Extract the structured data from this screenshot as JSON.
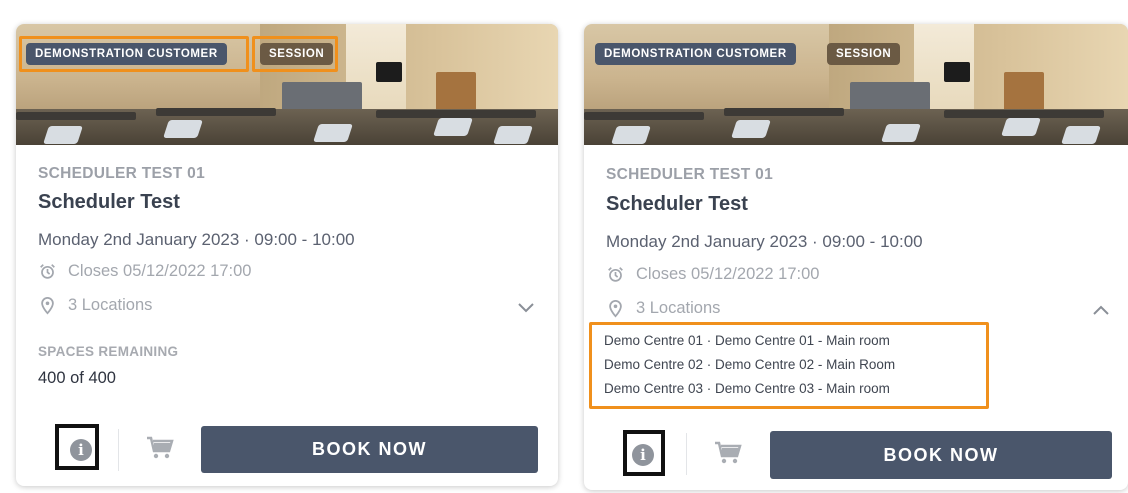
{
  "cards": [
    {
      "badges": {
        "customer": "DEMONSTRATION CUSTOMER",
        "session": "SESSION"
      },
      "subtitle": "SCHEDULER TEST 01",
      "title": "Scheduler Test",
      "datetime": "Monday 2nd January 2023 · 09:00 - 10:00",
      "closes": "Closes 05/12/2022 17:00",
      "locations_count": "3 Locations",
      "locations_expanded": false,
      "spaces_label": "SPACES REMAINING",
      "spaces_value": "400 of 400",
      "book_label": "BOOK NOW"
    },
    {
      "badges": {
        "customer": "DEMONSTRATION CUSTOMER",
        "session": "SESSION"
      },
      "subtitle": "SCHEDULER TEST 01",
      "title": "Scheduler Test",
      "datetime": "Monday 2nd January 2023 · 09:00 - 10:00",
      "closes": "Closes 05/12/2022 17:00",
      "locations_count": "3 Locations",
      "locations_expanded": true,
      "locations": [
        "Demo Centre 01 · Demo Centre 01 - Main room",
        "Demo Centre 02 · Demo Centre 02 - Main Room",
        "Demo Centre 03 · Demo Centre 03 - Main room"
      ],
      "book_label": "BOOK NOW"
    }
  ],
  "icons": {
    "alarm": "alarm-clock-icon",
    "location": "map-pin-icon",
    "chevron_down": "chevron-down-icon",
    "chevron_up": "chevron-up-icon",
    "info": "info-icon",
    "cart": "shopping-cart-icon"
  },
  "colors": {
    "badge_customer": "#4a566b",
    "badge_session": "#6b5a44",
    "book_button": "#4a566b",
    "highlight": "#f0901c"
  }
}
